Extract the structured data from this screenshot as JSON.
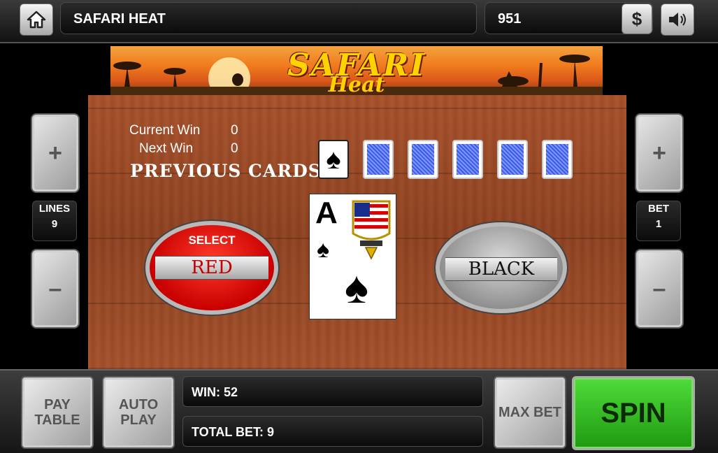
{
  "header": {
    "title": "SAFARI HEAT",
    "balance": "951",
    "dollar_label": "$"
  },
  "banner": {
    "title": "SAFARI",
    "subtitle": "Heat"
  },
  "gamble": {
    "current_win_label": "Current Win",
    "current_win_value": "0",
    "next_win_label": "Next Win",
    "next_win_value": "0",
    "previous_cards_label": "PREVIOUS CARDS",
    "previous_cards": [
      {
        "type": "face",
        "suit": "♠"
      },
      {
        "type": "back"
      },
      {
        "type": "back"
      },
      {
        "type": "back"
      },
      {
        "type": "back"
      },
      {
        "type": "back"
      }
    ],
    "current_card": {
      "rank": "A",
      "suit": "♠"
    },
    "select_label": "SELECT",
    "red_label": "RED",
    "black_label": "BLACK"
  },
  "lines": {
    "plus": "+",
    "minus": "–",
    "label": "LINES",
    "value": "9"
  },
  "bet": {
    "plus": "+",
    "minus": "–",
    "label": "BET",
    "value": "1"
  },
  "footer": {
    "pay_table": "PAY TABLE",
    "auto_play": "AUTO PLAY",
    "win_label": "WIN:",
    "win_value": "52",
    "total_bet_label": "TOTAL BET:",
    "total_bet_value": "9",
    "max_bet": "MAX BET",
    "spin": "SPIN"
  },
  "colors": {
    "spin_green": "#2fbf1f",
    "red_button": "#e00000",
    "wood": "#9a4a25"
  }
}
